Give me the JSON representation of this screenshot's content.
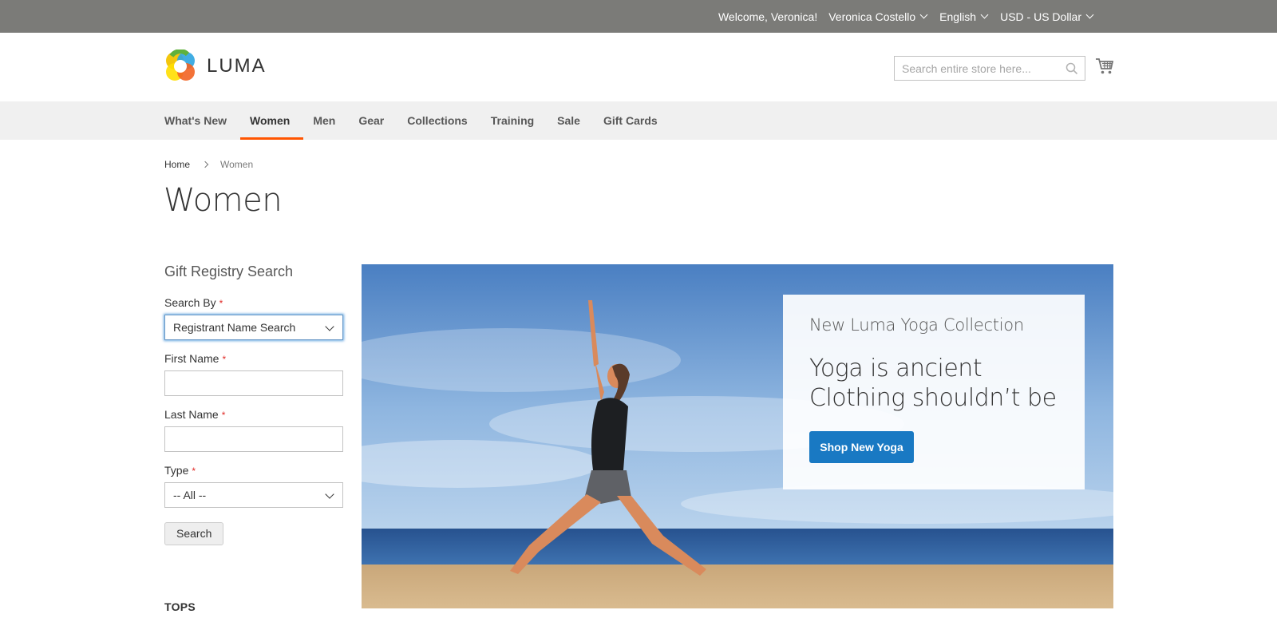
{
  "top_bar": {
    "welcome": "Welcome, Veronica!",
    "account_name": "Veronica Costello",
    "language": "English",
    "currency": "USD - US Dollar"
  },
  "header": {
    "logo_text": "LUMA",
    "search_placeholder": "Search entire store here...",
    "icons": [
      "search-icon",
      "cart-icon"
    ]
  },
  "nav": {
    "items": [
      "What's New",
      "Women",
      "Men",
      "Gear",
      "Collections",
      "Training",
      "Sale",
      "Gift Cards"
    ],
    "active": "Women",
    "accent_color": "#ff5501"
  },
  "breadcrumbs": [
    "Home",
    "Women"
  ],
  "page_title": "Women",
  "sidebar": {
    "gift_registry": {
      "title": "Gift Registry Search",
      "search_by_label": "Search By",
      "search_by_value": "Registrant Name Search",
      "first_name_label": "First Name",
      "first_name_value": "",
      "last_name_label": "Last Name",
      "last_name_value": "",
      "type_label": "Type",
      "type_value": "-- All --",
      "search_button": "Search",
      "required_marker": "*"
    },
    "tops_heading": "TOPS"
  },
  "hero": {
    "subtitle": "New Luma Yoga Collection",
    "headline_line1": "Yoga is ancient",
    "headline_line2": "Clothing shouldn’t be",
    "cta": "Shop New Yoga",
    "cta_color": "#1979c3"
  }
}
